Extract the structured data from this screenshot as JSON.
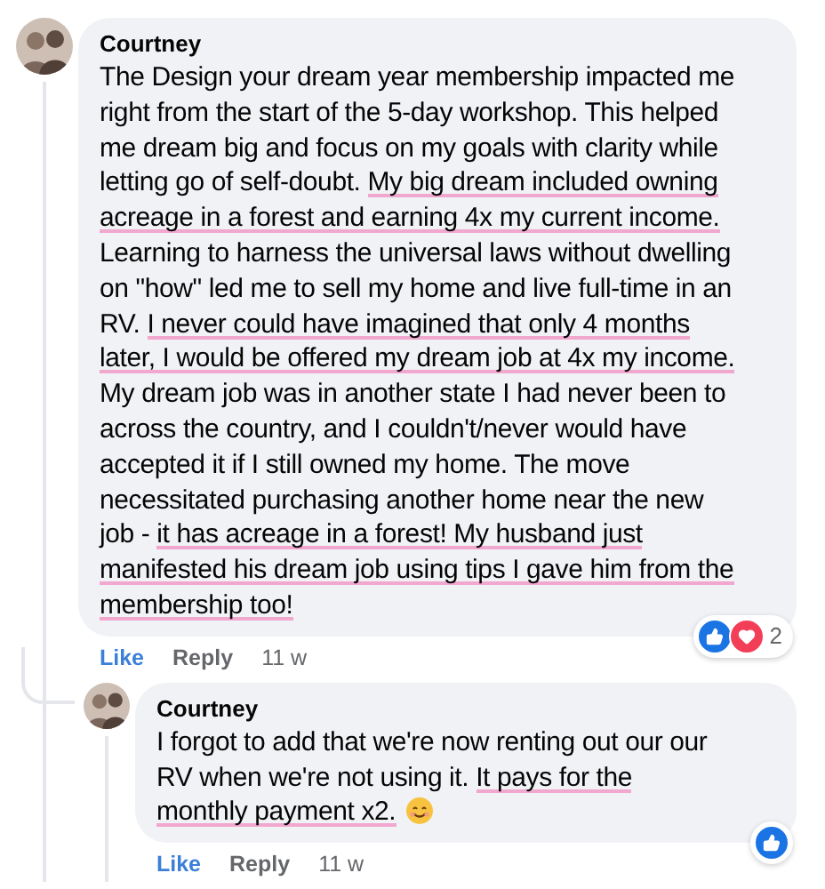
{
  "comment": {
    "author": "Courtney",
    "lines": [
      [
        {
          "text": "The Design your dream year membership impacted me",
          "highlighted": false
        }
      ],
      [
        {
          "text": "right from the start of the 5-day workshop. This helped",
          "highlighted": false
        }
      ],
      [
        {
          "text": "me dream big and focus on my goals with clarity while",
          "highlighted": false
        }
      ],
      [
        {
          "text": "letting go of self-doubt. ",
          "highlighted": false
        },
        {
          "text": "My big dream included owning",
          "highlighted": true
        }
      ],
      [
        {
          "text": "acreage in a forest and earning 4x my current income.",
          "highlighted": true
        }
      ],
      [
        {
          "text": "Learning to harness the universal laws without dwelling",
          "highlighted": false
        }
      ],
      [
        {
          "text": "on \"how\" led me to sell my home and live full-time in an",
          "highlighted": false
        }
      ],
      [
        {
          "text": "RV. ",
          "highlighted": false
        },
        {
          "text": "I never could have imagined that only 4 months",
          "highlighted": true
        }
      ],
      [
        {
          "text": "later, I would be offered my dream job at 4x my income.",
          "highlighted": true
        }
      ],
      [
        {
          "text": "My dream job was in another state I had never been to",
          "highlighted": false
        }
      ],
      [
        {
          "text": "across the country, and I couldn't/never would have",
          "highlighted": false
        }
      ],
      [
        {
          "text": "accepted it if I still owned my home. The move",
          "highlighted": false
        }
      ],
      [
        {
          "text": "necessitated purchasing another home near the new",
          "highlighted": false
        }
      ],
      [
        {
          "text": "job - ",
          "highlighted": false
        },
        {
          "text": "it has acreage in a forest! My husband just",
          "highlighted": true
        }
      ],
      [
        {
          "text": "manifested his dream job using tips I gave him from the",
          "highlighted": true
        }
      ],
      [
        {
          "text": "membership too!",
          "highlighted": true
        }
      ]
    ],
    "reactions": {
      "items": [
        {
          "kind": "like"
        },
        {
          "kind": "love"
        }
      ],
      "count": "2"
    },
    "actions": [
      {
        "label": "Like",
        "kind": "like"
      },
      {
        "label": "Reply",
        "kind": "reply"
      },
      {
        "label": "11 w",
        "kind": "time"
      }
    ],
    "replies": [
      {
        "author": "Courtney",
        "lines": [
          [
            {
              "text": "I forgot to add that we're now renting out our our",
              "highlighted": false
            }
          ],
          [
            {
              "text": "RV when we're not using it. ",
              "highlighted": false
            },
            {
              "text": "It pays for the",
              "highlighted": true
            }
          ],
          [
            {
              "text": "monthly payment x2.",
              "highlighted": true
            }
          ]
        ],
        "smiley": true,
        "reactions": {
          "items": [
            {
              "kind": "like"
            }
          ]
        },
        "actions": [
          {
            "label": "Like",
            "kind": "like"
          },
          {
            "label": "Reply",
            "kind": "reply"
          },
          {
            "label": "11 w",
            "kind": "time"
          }
        ]
      }
    ]
  }
}
